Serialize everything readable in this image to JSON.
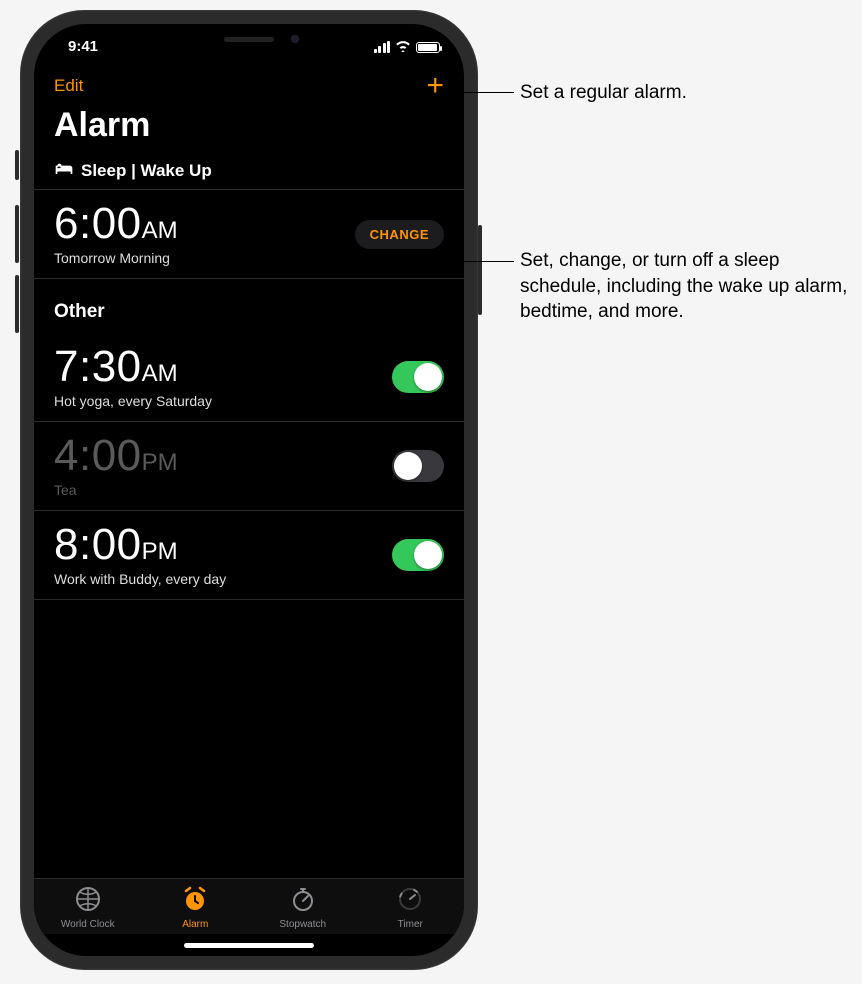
{
  "status": {
    "time": "9:41"
  },
  "nav": {
    "edit_label": "Edit",
    "add_label": "+"
  },
  "title": "Alarm",
  "sleep_section": {
    "header": "Sleep | Wake Up",
    "time": "6:00",
    "ampm": "AM",
    "subtitle": "Tomorrow Morning",
    "change_label": "CHANGE"
  },
  "other_section": {
    "header": "Other",
    "alarms": [
      {
        "time": "7:30",
        "ampm": "AM",
        "label": "Hot yoga, every Saturday",
        "on": true
      },
      {
        "time": "4:00",
        "ampm": "PM",
        "label": "Tea",
        "on": false
      },
      {
        "time": "8:00",
        "ampm": "PM",
        "label": "Work with Buddy, every day",
        "on": true
      }
    ]
  },
  "tabs": [
    {
      "label": "World Clock",
      "active": false
    },
    {
      "label": "Alarm",
      "active": true
    },
    {
      "label": "Stopwatch",
      "active": false
    },
    {
      "label": "Timer",
      "active": false
    }
  ],
  "callouts": {
    "add": "Set a regular alarm.",
    "change": "Set, change, or turn off a sleep schedule, including the wake up alarm, bedtime, and more."
  }
}
